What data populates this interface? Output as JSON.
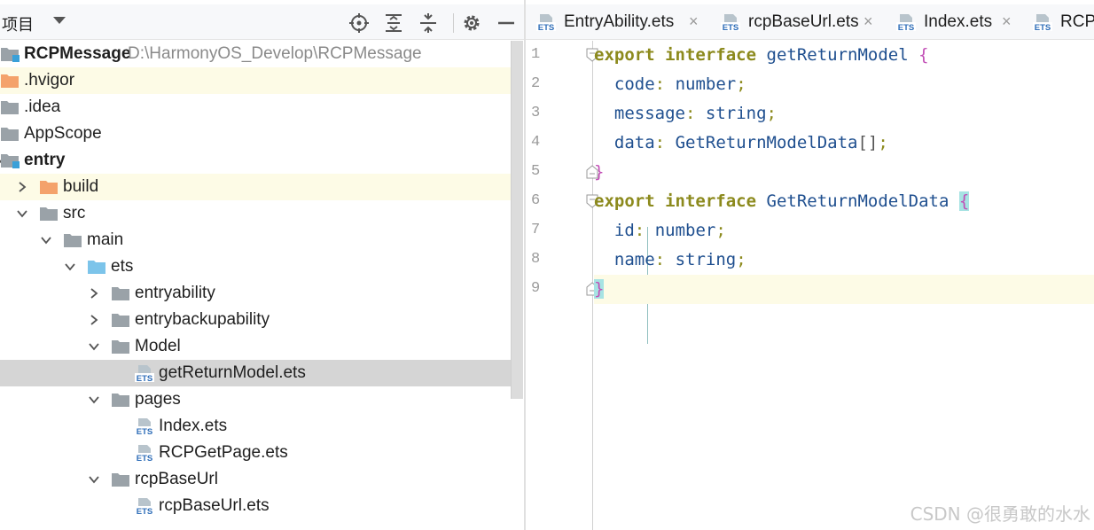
{
  "panel": {
    "title": "项目",
    "header_icons": [
      "locate-icon",
      "expand-all-icon",
      "collapse-all-icon",
      "gear-icon",
      "minimize-icon"
    ]
  },
  "tree": [
    {
      "label": "RCPMessage",
      "path": "D:\\HarmonyOS_Develop\\RCPMessage",
      "kind": "module-folder",
      "bold": true
    },
    {
      "label": ".hvigor",
      "kind": "orange-folder"
    },
    {
      "label": ".idea",
      "kind": "folder"
    },
    {
      "label": "AppScope",
      "kind": "folder"
    },
    {
      "label": "entry",
      "kind": "module-folder",
      "bold": true,
      "arrow": "expanded"
    },
    {
      "label": "build",
      "kind": "orange-folder",
      "arrow": "collapsed"
    },
    {
      "label": "src",
      "kind": "folder",
      "arrow": "expanded"
    },
    {
      "label": "main",
      "kind": "folder",
      "arrow": "expanded"
    },
    {
      "label": "ets",
      "kind": "blue-folder",
      "arrow": "expanded"
    },
    {
      "label": "entryability",
      "kind": "folder",
      "arrow": "collapsed"
    },
    {
      "label": "entrybackupability",
      "kind": "folder",
      "arrow": "collapsed"
    },
    {
      "label": "Model",
      "kind": "folder",
      "arrow": "expanded"
    },
    {
      "label": "getReturnModel.ets",
      "kind": "ets-file",
      "selected": true
    },
    {
      "label": "pages",
      "kind": "folder",
      "arrow": "expanded"
    },
    {
      "label": "Index.ets",
      "kind": "ets-file"
    },
    {
      "label": "RCPGetPage.ets",
      "kind": "ets-file"
    },
    {
      "label": "rcpBaseUrl",
      "kind": "folder",
      "arrow": "expanded"
    },
    {
      "label": "rcpBaseUrl.ets",
      "kind": "ets-file"
    }
  ],
  "tabs": [
    {
      "label": "EntryAbility.ets",
      "close": "×"
    },
    {
      "label": "rcpBaseUrl.ets",
      "close": "×"
    },
    {
      "label": "Index.ets",
      "close": "×"
    },
    {
      "label": "RCPG"
    }
  ],
  "ets_badge": "ETS",
  "line_numbers": [
    "1",
    "2",
    "3",
    "4",
    "5",
    "6",
    "7",
    "8",
    "9"
  ],
  "code": {
    "l1": {
      "kw1": "export",
      "kw2": "interface",
      "name": "getReturnModel",
      "brace": "{"
    },
    "l2": {
      "prop": "code",
      "colon": ":",
      "type": "number",
      "semi": ";"
    },
    "l3": {
      "prop": "message",
      "colon": ":",
      "type": "string",
      "semi": ";"
    },
    "l4": {
      "prop": "data",
      "colon": ":",
      "type": "GetReturnModelData",
      "arr": "[]",
      "semi": ";"
    },
    "l5": {
      "brace": "}"
    },
    "l6": {
      "kw1": "export",
      "kw2": "interface",
      "name": "GetReturnModelData",
      "brace": "{"
    },
    "l7": {
      "prop": "id",
      "colon": ":",
      "type": "number",
      "semi": ";"
    },
    "l8": {
      "prop": "name",
      "colon": ":",
      "type": "string",
      "semi": ";"
    },
    "l9": {
      "brace": "}"
    }
  },
  "watermark": "CSDN @很勇敢的水水",
  "colors": {
    "keyword": "#8c8a1d",
    "type": "#1f4f8f",
    "brace": "#c24fb6",
    "selection": "#d5d5d5",
    "current_line": "#fdfbe6"
  }
}
